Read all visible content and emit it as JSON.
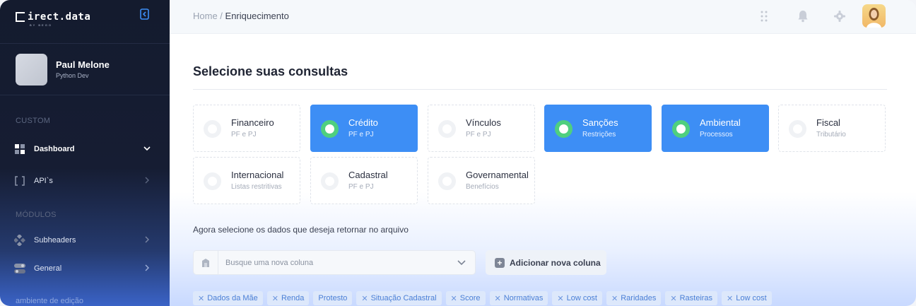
{
  "app": {
    "logo_text": "irect.data",
    "logo_sub": "BY BEGO"
  },
  "user": {
    "name": "Paul Melone",
    "role": "Python Dev"
  },
  "sidebar": {
    "section_custom": "CUSTOM",
    "section_modules": "MÓDULOS",
    "items": [
      {
        "label": "Dashboard",
        "icon": "grid-icon",
        "active": true
      },
      {
        "label": "API`s",
        "icon": "brackets-icon",
        "active": false
      },
      {
        "label": "Subheaders",
        "icon": "diamond-icon",
        "active": false
      },
      {
        "label": "General",
        "icon": "toggle-icon",
        "active": false
      }
    ],
    "bottom_hint": "ambiente de edição"
  },
  "header": {
    "breadcrumb_home": "Home",
    "breadcrumb_sep": " / ",
    "breadcrumb_current": "Enriquecimento"
  },
  "main": {
    "title": "Selecione suas consultas",
    "cards": [
      {
        "title": "Financeiro",
        "subtitle": "PF e PJ",
        "selected": false
      },
      {
        "title": "Crédito",
        "subtitle": "PF e PJ",
        "selected": true
      },
      {
        "title": "Vínculos",
        "subtitle": "PF e PJ",
        "selected": false
      },
      {
        "title": "Sanções",
        "subtitle": "Restrições",
        "selected": true
      },
      {
        "title": "Ambiental",
        "subtitle": "Processos",
        "selected": true
      },
      {
        "title": "Fiscal",
        "subtitle": "Tributário",
        "selected": false
      },
      {
        "title": "Internacional",
        "subtitle": "Listas restritivas",
        "selected": false
      },
      {
        "title": "Cadastral",
        "subtitle": "PF e PJ",
        "selected": false
      },
      {
        "title": "Governamental",
        "subtitle": "Benefícios",
        "selected": false
      }
    ],
    "data_label": "Agora selecione os dados que deseja retornar no arquivo",
    "search_placeholder": "Busque uma nova coluna",
    "add_column_label": "Adicionar nova coluna",
    "tags": [
      "Dados da Mãe",
      "Renda",
      "Protesto",
      "Situação Cadastral",
      "Score",
      "Normativas",
      "Low cost",
      "Raridades",
      "Rasteiras",
      "Low cost"
    ]
  },
  "colors": {
    "accent": "#3d8ef5",
    "selected_radio": "#4fcf7f",
    "sidebar_bg": "#141b2e"
  }
}
